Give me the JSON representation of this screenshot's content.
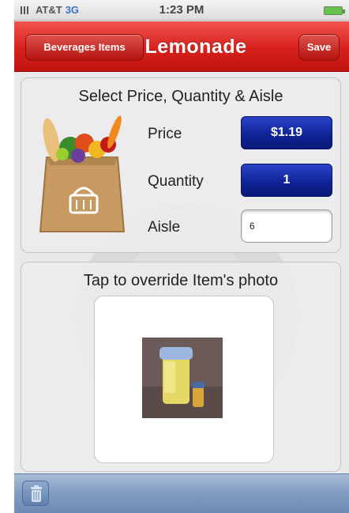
{
  "status_bar": {
    "carrier": "AT&T",
    "network": "3G",
    "time": "1:23 PM"
  },
  "nav": {
    "back_label": "Beverages Items",
    "title": "Lemonade",
    "save_label": "Save"
  },
  "details": {
    "heading": "Select Price, Quantity & Aisle",
    "price_label": "Price",
    "price_value": "$1.19",
    "quantity_label": "Quantity",
    "quantity_value": "1",
    "aisle_label": "Aisle",
    "aisle_value": "6"
  },
  "photo": {
    "heading": "Tap to override Item's photo"
  },
  "toolbar": {
    "trash_icon": "trash-icon"
  },
  "colors": {
    "nav_red": "#d8201c",
    "value_button_blue": "#0f2294",
    "toolbar_blue": "#7f9bbf"
  }
}
